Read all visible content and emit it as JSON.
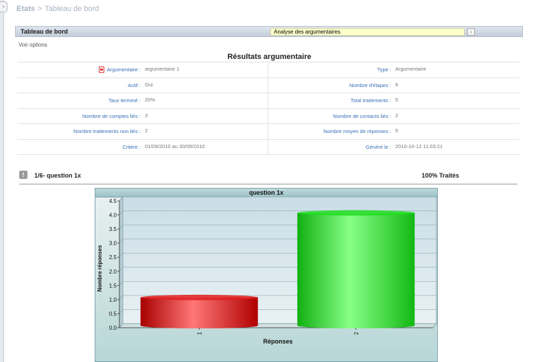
{
  "breadcrumb": {
    "root": "Etats",
    "separator": ">",
    "current": "Tableau de bord"
  },
  "header": {
    "title": "Tableau de bord",
    "selected_report": "Analyse des argumentaires"
  },
  "options_link": "Voir options",
  "results": {
    "title": "Résultats argumentaire",
    "rows": [
      {
        "left_label": "Argumentaire :",
        "left_value": "argumentaire 1",
        "right_label": "Type :",
        "right_value": "Argumentaire"
      },
      {
        "left_label": "Actif :",
        "left_value": "Oui",
        "right_label": "Nombre d'étapes :",
        "right_value": "6"
      },
      {
        "left_label": "Taux terminé :",
        "left_value": "20%",
        "right_label": "Total traitements :",
        "right_value": "5"
      },
      {
        "left_label": "Nombre de comptes liés :",
        "left_value": "3",
        "right_label": "Nombre de contacts liés :",
        "right_value": "2"
      },
      {
        "left_label": "Nombre traitements non liés :",
        "left_value": "2",
        "right_label": "Nombre moyen de réponses :",
        "right_value": "5"
      },
      {
        "left_label": "Critère :",
        "left_value": "01/09/2010 au 30/09/2010",
        "right_label": "Généré le :",
        "right_value": "2010-10-12 11:03:21"
      }
    ]
  },
  "question": {
    "icon": "!",
    "label": "1/6- question 1x",
    "status": "100% Traités"
  },
  "chart_data": {
    "type": "bar",
    "title": "question 1x",
    "xlabel": "Réponses",
    "ylabel": "Nombre réponses",
    "categories": [
      "1",
      "2"
    ],
    "values": [
      1,
      4
    ],
    "colors": [
      "#e02020",
      "#22dd22"
    ],
    "ylim": [
      0,
      4.5
    ],
    "yticks": [
      "0.0",
      "0.5",
      "1.0",
      "1.5",
      "2.0",
      "2.5",
      "3.0",
      "3.5",
      "4.0",
      "4.5"
    ],
    "grid": true
  }
}
